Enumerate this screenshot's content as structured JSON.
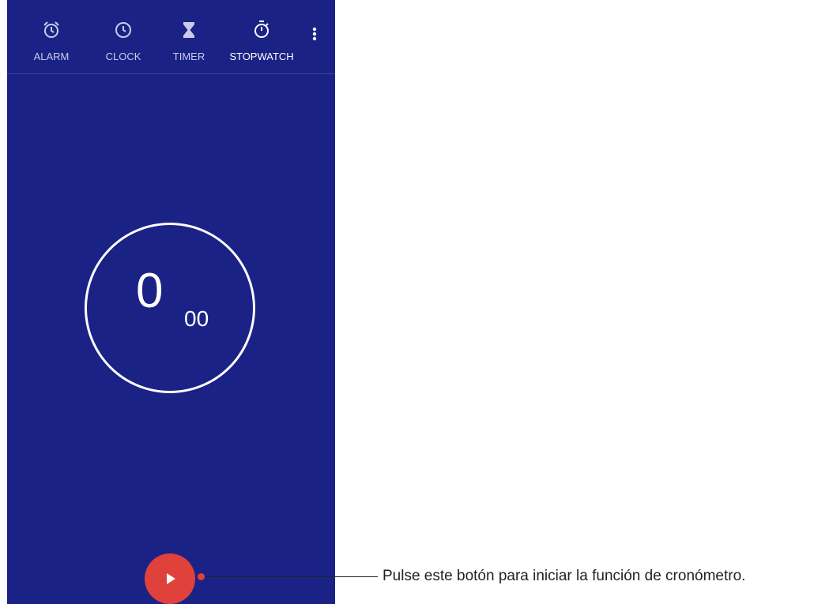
{
  "tabs": [
    {
      "label": "ALARM",
      "icon": "alarm-icon",
      "active": false
    },
    {
      "label": "CLOCK",
      "icon": "clock-icon",
      "active": false
    },
    {
      "label": "TIMER",
      "icon": "hourglass-icon",
      "active": false
    },
    {
      "label": "STOPWATCH",
      "icon": "stopwatch-icon",
      "active": true
    }
  ],
  "stopwatch": {
    "seconds": "0",
    "hundredths": "00"
  },
  "fab": {
    "icon": "play-icon"
  },
  "callout": {
    "text": "Pulse este botón para iniciar la función de cronómetro."
  },
  "colors": {
    "background": "#1b2286",
    "accent": "#e0413a",
    "text": "#ffffff"
  }
}
